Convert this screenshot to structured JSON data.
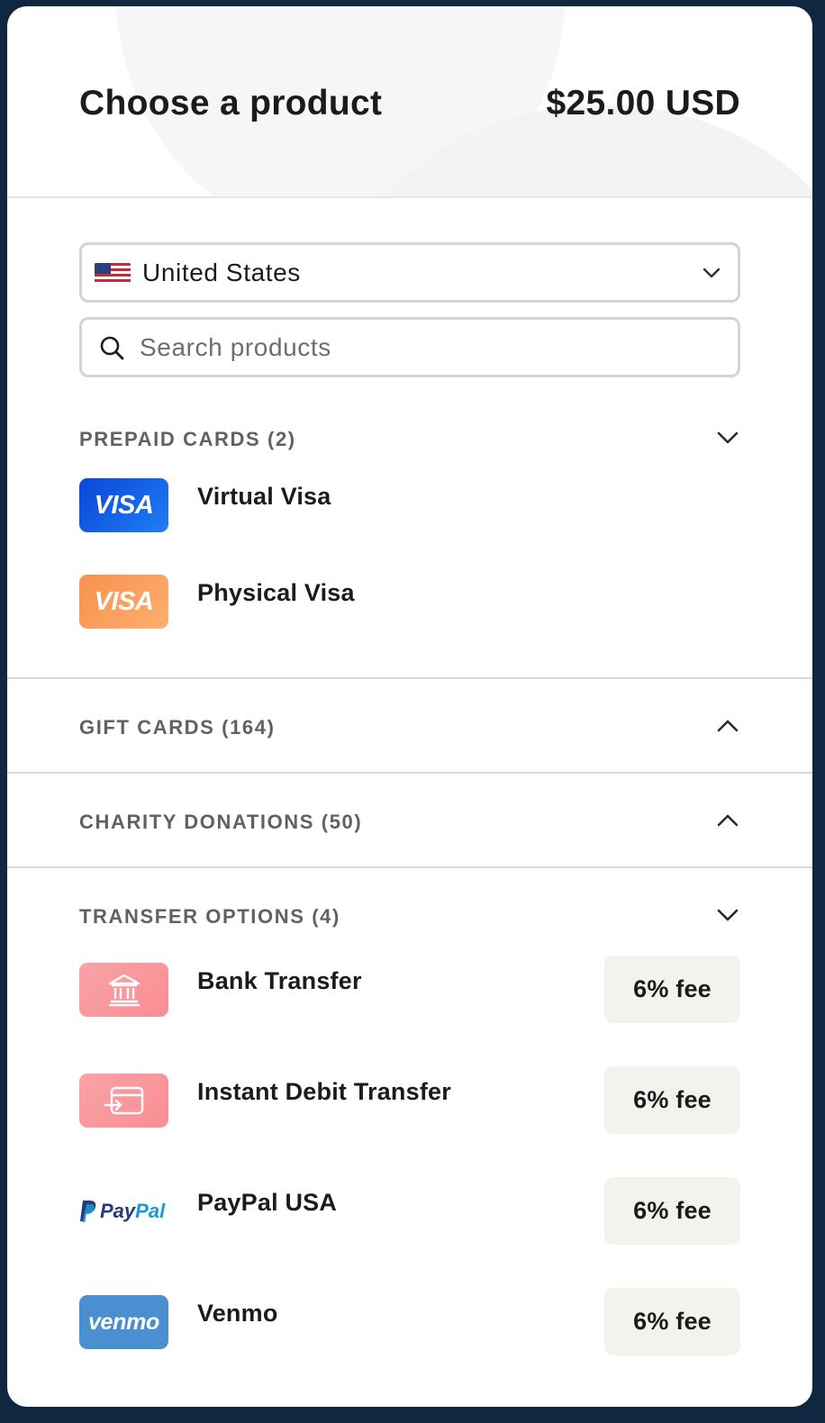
{
  "header": {
    "title": "Choose a product",
    "price": "$25.00 USD"
  },
  "country": {
    "selected": "United States",
    "icon": "us-flag-icon"
  },
  "search": {
    "placeholder": "Search products"
  },
  "sections": [
    {
      "label": "PREPAID CARDS (2)",
      "expanded": true,
      "items": [
        {
          "name": "Virtual Visa",
          "logo_text": "VISA",
          "logo_color": "#1565f0"
        },
        {
          "name": "Physical Visa",
          "logo_text": "VISA",
          "logo_color": "#ff9f5e"
        }
      ]
    },
    {
      "label": "GIFT CARDS (164)",
      "expanded": false
    },
    {
      "label": "CHARITY DONATIONS (50)",
      "expanded": false
    },
    {
      "label": "TRANSFER OPTIONS (4)",
      "expanded": true,
      "items": [
        {
          "name": "Bank Transfer",
          "icon": "bank-icon",
          "fee": "6% fee"
        },
        {
          "name": "Instant Debit Transfer",
          "icon": "debit-card-icon",
          "fee": "6% fee"
        },
        {
          "name": "PayPal USA",
          "logo_text": "PayPal",
          "fee": "6% fee"
        },
        {
          "name": "Venmo",
          "logo_text": "venmo",
          "fee": "6% fee"
        }
      ]
    }
  ],
  "colors": {
    "page_background": "#0f2740",
    "fee_badge": "#f4f2ed",
    "section_label": "#606068"
  }
}
